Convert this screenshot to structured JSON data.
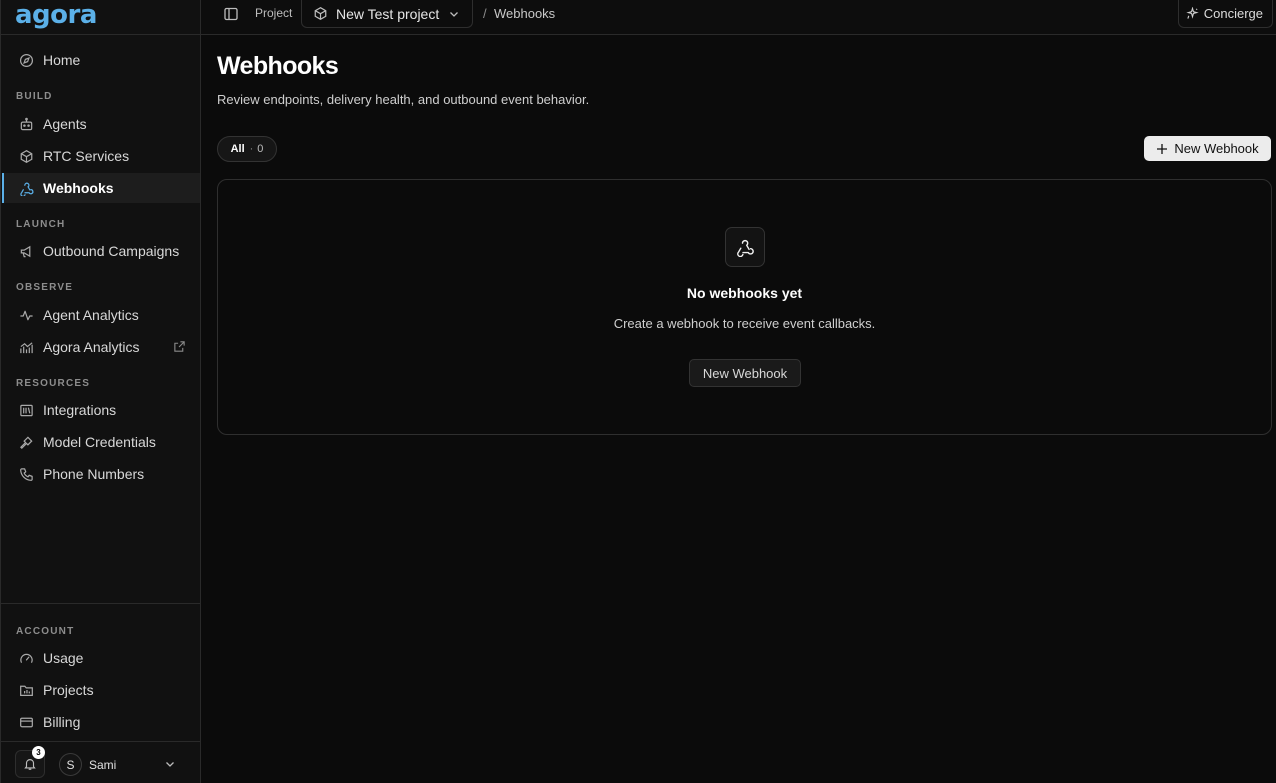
{
  "brand": {
    "logo_text": "agora",
    "accent": "#5bb0e8"
  },
  "sidebar": {
    "home": {
      "label": "Home",
      "icon": "compass-icon"
    },
    "sections": {
      "build": "BUILD",
      "launch": "LAUNCH",
      "observe": "OBSERVE",
      "resources": "RESOURCES",
      "account": "ACCOUNT"
    },
    "items": {
      "agents": "Agents",
      "rtc_services": "RTC Services",
      "webhooks": "Webhooks",
      "outbound_campaigns": "Outbound Campaigns",
      "agent_analytics": "Agent Analytics",
      "agora_analytics": "Agora Analytics",
      "integrations": "Integrations",
      "model_credentials": "Model Credentials",
      "phone_numbers": "Phone Numbers",
      "usage": "Usage",
      "projects": "Projects",
      "billing": "Billing"
    },
    "active": "webhooks",
    "footer": {
      "notification_count": "3",
      "avatar_initial": "S",
      "user_name": "Sami"
    }
  },
  "topbar": {
    "project_label": "Project",
    "project_name": "New Test project",
    "separator": "/",
    "current_page": "Webhooks",
    "concierge_label": "Concierge"
  },
  "main": {
    "title": "Webhooks",
    "subtitle": "Review endpoints, delivery health, and outbound event behavior.",
    "filter": {
      "label": "All",
      "separator": "·",
      "count": "0"
    },
    "new_button_label": "New Webhook",
    "empty_state": {
      "title": "No webhooks yet",
      "description": "Create a webhook to receive event callbacks.",
      "button_label": "New Webhook",
      "icon": "webhook-icon"
    }
  }
}
